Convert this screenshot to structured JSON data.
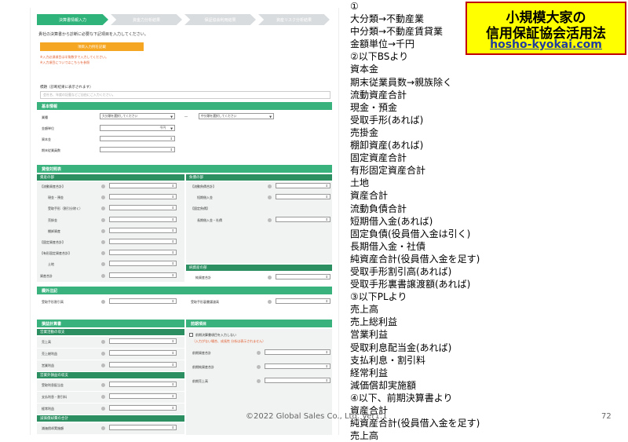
{
  "screenshot": {
    "steps": [
      "決算書情報入力",
      "資金力分析結果",
      "保証協会利用結果",
      "資産リスク分析結果"
    ],
    "intro_text": "貴社の決算書から診断に必要な下記項目を入力してください。",
    "orange_button": "項目入力例を記載",
    "note1": "※入力必須項目は半角数字で入力してください。",
    "note2": "※入力項目についてはこちらを参照",
    "title_label": "標題（診断結果に表示されます）",
    "title_placeholder": "会社名、年度の記載などご自由にご入力ください。",
    "basic_section": "基本情報",
    "basic": {
      "industry_label": "業種",
      "industry_major": "大分類を選択してください",
      "industry_mid": "中分類を選択してください",
      "dash": "―",
      "unit_label": "金額単位",
      "unit_value": "千円",
      "capital_label": "資本金",
      "employees_label": "期末従業員数"
    },
    "bs_section": "貸借対照表",
    "bs_left_head": "資産の部",
    "bs_right_head": "負債の部",
    "bs_left_rows": [
      "【流動資産合計】",
      "現金・預金",
      "受取手形（割引分除く）",
      "売掛金",
      "棚卸資産",
      "【固定資産合計】",
      "【有形固定資産合計】",
      "土地",
      "資産合計"
    ],
    "bs_right_rows": [
      "【流動負債合計】",
      "短期借入金",
      "【固定負債】",
      "長期借入金・社債"
    ],
    "equity_head": "純資産の部",
    "equity_row": "純資産合計",
    "note_section": "欄外注記",
    "note_left": "受取手形割引高",
    "note_right": "受取手形裏書譲渡高",
    "pl_section": "損益計算書",
    "pl_sub1": "営業活動の収支",
    "pl_rows1": [
      "売上高",
      "売上総利益",
      "営業利益"
    ],
    "pl_sub2": "営業外損益の収支",
    "pl_rows2": [
      "受取利息配当金",
      "支払利息・割引料",
      "経常利益"
    ],
    "pl_sub3": "減価償却費の合計",
    "pl_rows3": [
      "減価償却実施額"
    ],
    "prev_section": "前期項目",
    "prev_check": "前期決算書項目を入力しない",
    "prev_warn": "（入力がない場合、成長性 分析は表示されません）",
    "prev_rows": [
      "前期資産合計",
      "前期純資産合計",
      "前期売上高"
    ]
  },
  "badge": {
    "line1": "小規模大家の",
    "line2": "信用保証協会活用法",
    "line3": "hosho-kyokai.com"
  },
  "notes": [
    "①",
    "大分類→不動産業",
    "中分類→不動産賃貸業",
    "金額単位→千円",
    "②以下BSより",
    "資本金",
    "期末従業員数→親族除く",
    "流動資産合計",
    "現金・預金",
    "受取手形(あれば)",
    "売掛金",
    "棚卸資産(あれば)",
    "固定資産合計",
    "有形固定資産合計",
    "土地",
    "資産合計",
    "流動負債合計",
    "短期借入金(あれば)",
    "固定負債(役員借入金は引く)",
    "長期借入金・社債",
    "純資産合計(役員借入金を足す)",
    "受取手形割引高(あれば)",
    "受取手形裏書譲渡額(あれば)",
    "③以下PLより",
    "売上高",
    "売上総利益",
    "営業利益",
    "受取利息配当金(あれば)",
    "支払利息・割引料",
    "経常利益",
    "減価償却実施額",
    "④以下、前期決算書より",
    "資産合計",
    "純資産合計(役員借入金を足す)",
    "売上高"
  ],
  "footer": "©2022 Global Sales Co., Ltd. Ver1.1",
  "page_number": "72",
  "colors": {
    "accent": "#3ab27e",
    "badge_bg": "#ffff00",
    "badge_border": "#c00000",
    "orange": "#f5a623"
  }
}
